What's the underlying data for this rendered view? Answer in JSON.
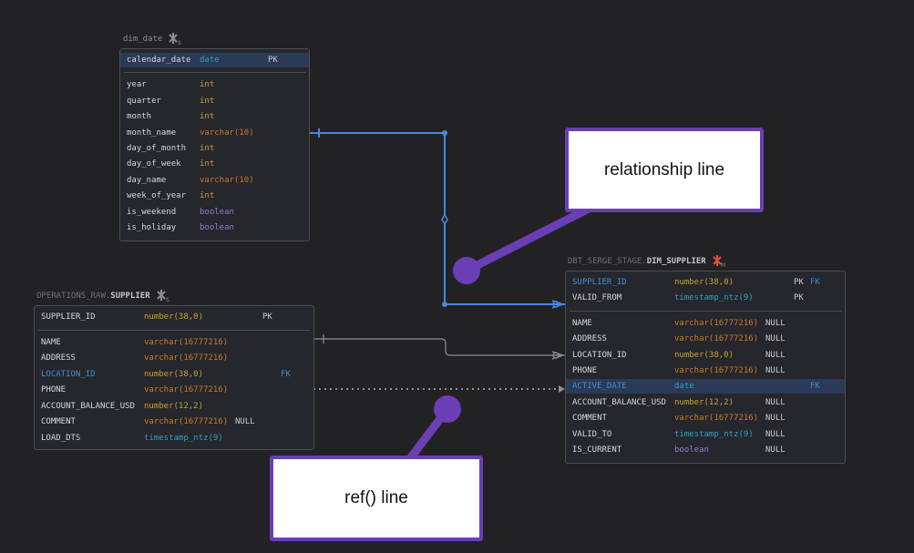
{
  "tables": {
    "dim_date": {
      "title": "dim_date",
      "key_rows": [
        {
          "name": "calendar_date",
          "type": "date",
          "key": "PK",
          "type_color": "cyan"
        }
      ],
      "rows": [
        {
          "name": "year",
          "type": "int",
          "type_color": "yellow"
        },
        {
          "name": "quarter",
          "type": "int",
          "type_color": "yellow"
        },
        {
          "name": "month",
          "type": "int",
          "type_color": "yellow"
        },
        {
          "name": "month_name",
          "type": "varchar(10)",
          "type_color": "orange"
        },
        {
          "name": "day_of_month",
          "type": "int",
          "type_color": "yellow"
        },
        {
          "name": "day_of_week",
          "type": "int",
          "type_color": "yellow"
        },
        {
          "name": "day_name",
          "type": "varchar(10)",
          "type_color": "orange"
        },
        {
          "name": "week_of_year",
          "type": "int",
          "type_color": "yellow"
        },
        {
          "name": "is_weekend",
          "type": "boolean",
          "type_color": "purple"
        },
        {
          "name": "is_holiday",
          "type": "boolean",
          "type_color": "purple"
        }
      ]
    },
    "supplier": {
      "schema": "OPERATIONS_RAW.",
      "title": "SUPPLIER",
      "key_rows": [
        {
          "name": "SUPPLIER_ID",
          "type": "number(38,0)",
          "key": "PK",
          "type_color": "yellow"
        }
      ],
      "rows": [
        {
          "name": "NAME",
          "type": "varchar(16777216)",
          "type_color": "orange"
        },
        {
          "name": "ADDRESS",
          "type": "varchar(16777216)",
          "type_color": "orange"
        },
        {
          "name": "LOCATION_ID",
          "type": "number(38,0)",
          "type_color": "yellow",
          "fk": "FK",
          "name_color": "blue"
        },
        {
          "name": "PHONE",
          "type": "varchar(16777216)",
          "type_color": "orange"
        },
        {
          "name": "ACCOUNT_BALANCE_USD",
          "type": "number(12,2)",
          "type_color": "yellow"
        },
        {
          "name": "COMMENT",
          "type": "varchar(16777216)",
          "type_color": "orange",
          "null": "NULL"
        },
        {
          "name": "LOAD_DTS",
          "type": "timestamp_ntz(9)",
          "type_color": "cyan"
        }
      ]
    },
    "dim_supplier": {
      "schema": "DBT_SERGE_STAGE.",
      "title": "DIM_SUPPLIER",
      "key_rows": [
        {
          "name": "SUPPLIER_ID",
          "type": "number(38,0)",
          "key": "PK",
          "fk": "FK",
          "type_color": "yellow",
          "name_color": "blue"
        },
        {
          "name": "VALID_FROM",
          "type": "timestamp_ntz(9)",
          "key": "PK",
          "type_color": "cyan"
        }
      ],
      "rows": [
        {
          "name": "NAME",
          "type": "varchar(16777216)",
          "type_color": "orange",
          "null": "NULL"
        },
        {
          "name": "ADDRESS",
          "type": "varchar(16777216)",
          "type_color": "orange",
          "null": "NULL"
        },
        {
          "name": "LOCATION_ID",
          "type": "number(38,0)",
          "type_color": "yellow",
          "null": "NULL"
        },
        {
          "name": "PHONE",
          "type": "varchar(16777216)",
          "type_color": "orange",
          "null": "NULL"
        },
        {
          "name": "ACTIVE_DATE",
          "type": "date",
          "type_color": "cyan",
          "fk": "FK",
          "name_color": "blue",
          "highlight": true
        },
        {
          "name": "ACCOUNT_BALANCE_USD",
          "type": "number(12,2)",
          "type_color": "yellow",
          "null": "NULL"
        },
        {
          "name": "COMMENT",
          "type": "varchar(16777216)",
          "type_color": "orange",
          "null": "NULL"
        },
        {
          "name": "VALID_TO",
          "type": "timestamp_ntz(9)",
          "type_color": "cyan",
          "null": "NULL"
        },
        {
          "name": "IS_CURRENT",
          "type": "boolean",
          "type_color": "purple",
          "null": "NULL"
        }
      ]
    }
  },
  "callouts": {
    "relationship": "relationship line",
    "ref": "ref() line"
  },
  "colors": {
    "relationship_line": "#4a86e0",
    "ref_line": "#8e9096",
    "callout_border": "#6a3fb5",
    "highlight_row": "#2b3a56"
  },
  "icons": {
    "snowflake_icon": "snowflake-icon",
    "model_icon": "model-icon"
  }
}
